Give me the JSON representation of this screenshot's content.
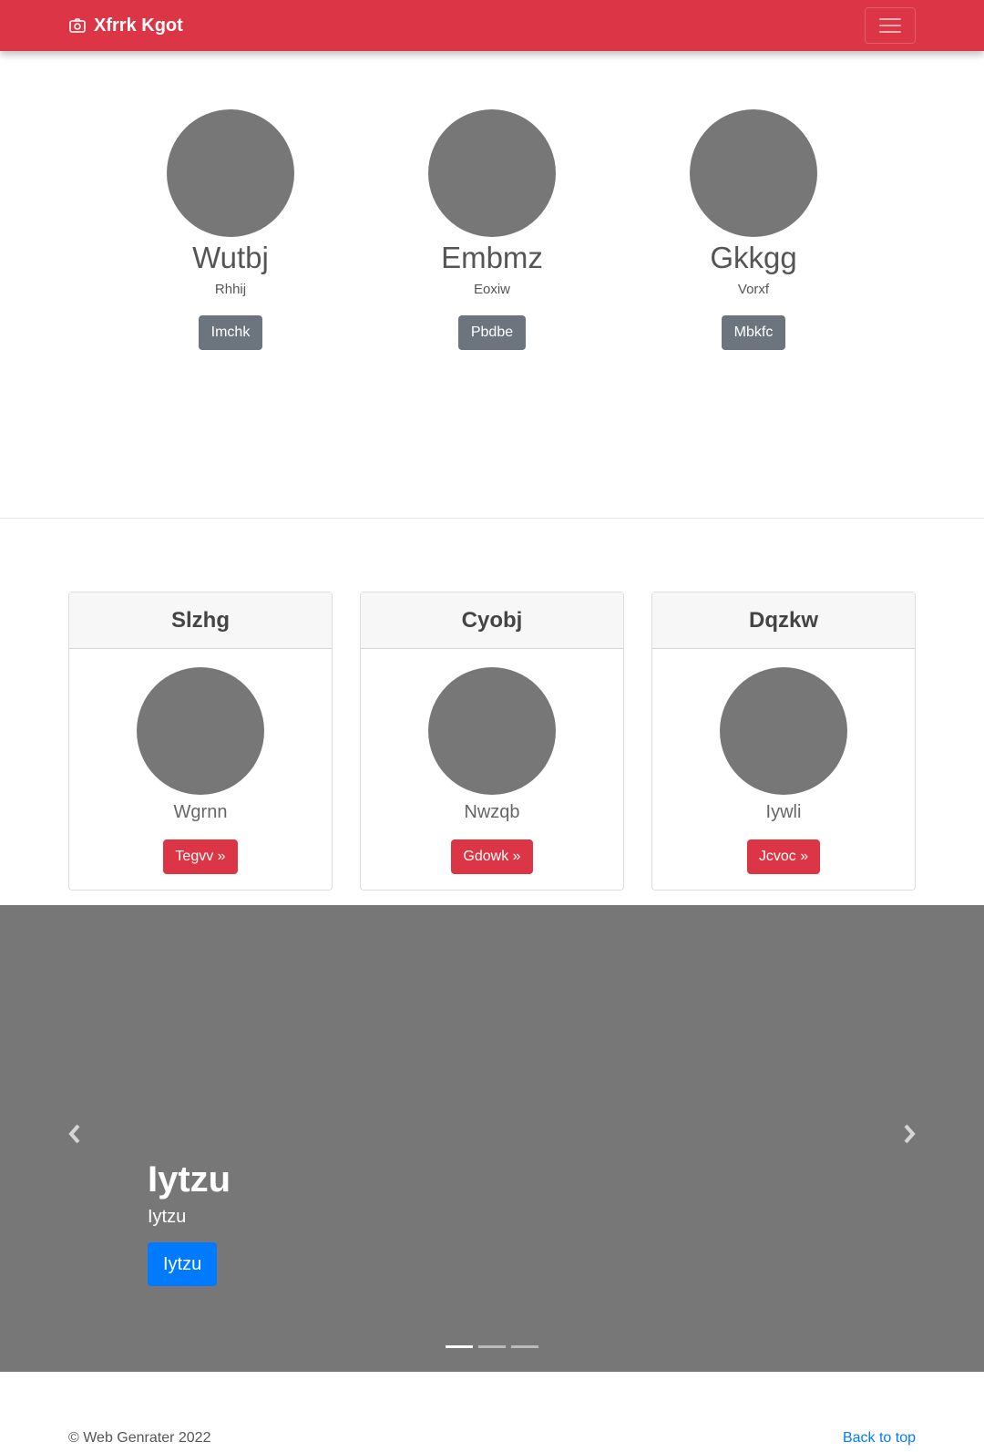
{
  "navbar": {
    "brand": "Xfrrk Kgot",
    "brand_icon": "camera-icon",
    "menu_icon": "hamburger-icon"
  },
  "people": [
    {
      "name": "Wutbj",
      "role": "Rhhij",
      "button": "Imchk"
    },
    {
      "name": "Embmz",
      "role": "Eoxiw",
      "button": "Pbdbe"
    },
    {
      "name": "Gkkgg",
      "role": "Vorxf",
      "button": "Mbkfc"
    }
  ],
  "cards": [
    {
      "header": "Slzhg",
      "subtitle": "Wgrnn",
      "button": "Tegvv »"
    },
    {
      "header": "Cyobj",
      "subtitle": "Nwzqb",
      "button": "Gdowk »"
    },
    {
      "header": "Dqzkw",
      "subtitle": "Iywli",
      "button": "Jcvoc »"
    }
  ],
  "carousel": {
    "title": "Iytzu",
    "text": "Iytzu",
    "button": "Iytzu",
    "active_slide": 1,
    "slide_count": 3
  },
  "footer": {
    "copyright": "© Web Genrater 2022",
    "back_to_top": "Back to top"
  },
  "colors": {
    "brand": "#dc3545",
    "primary": "#007bff",
    "secondary": "#6c757d",
    "placeholder": "#777777"
  }
}
